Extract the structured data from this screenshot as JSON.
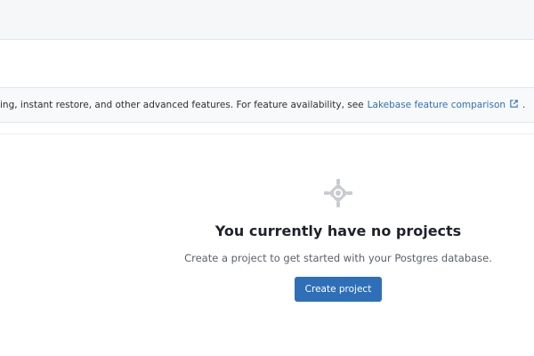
{
  "notice": {
    "text": "ing, instant restore, and other advanced features. For feature availability, see",
    "link_label": "Lakebase feature comparison",
    "link_icon": "external-link-icon",
    "period": "."
  },
  "empty_state": {
    "icon": "database-network-icon",
    "title": "You currently have no projects",
    "subtitle": "Create a project to get started with your Postgres database.",
    "button_label": "Create project"
  },
  "colors": {
    "accent": "#2f6fb7",
    "icon_gray": "#c8ccd1"
  }
}
